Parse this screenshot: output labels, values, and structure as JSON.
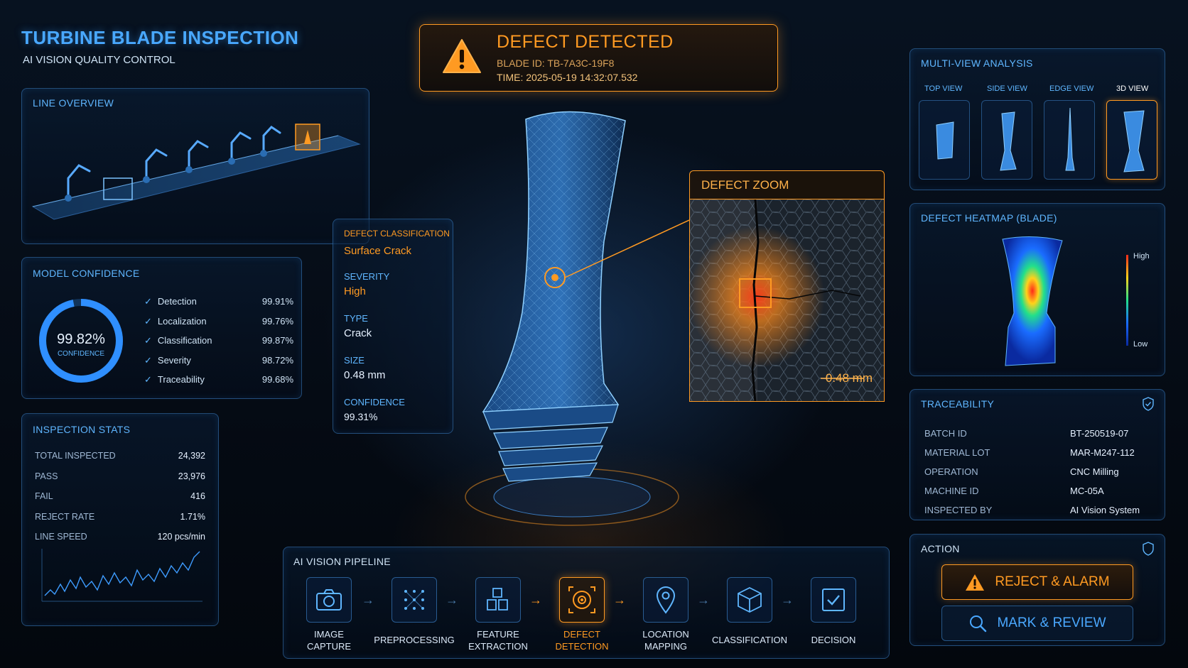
{
  "header": {
    "title": "TURBINE BLADE INSPECTION",
    "subtitle": "AI VISION QUALITY CONTROL"
  },
  "alert": {
    "title": "DEFECT DETECTED",
    "blade_id": "BLADE ID: TB-7A3C-19F8",
    "time": "TIME: 2025-05-19 14:32:07.532",
    "icon": "warning-icon",
    "color": "#ff9a22"
  },
  "line_overview": {
    "title": "LINE OVERVIEW"
  },
  "model_confidence": {
    "title": "MODEL CONFIDENCE",
    "overall_value": "99.82%",
    "overall_label": "CONFIDENCE",
    "overall_fraction": 0.9982,
    "rows": [
      {
        "label": "Detection",
        "value": "99.91%"
      },
      {
        "label": "Localization",
        "value": "99.76%"
      },
      {
        "label": "Classification",
        "value": "99.87%"
      },
      {
        "label": "Severity",
        "value": "98.72%"
      },
      {
        "label": "Traceability",
        "value": "99.68%"
      }
    ]
  },
  "inspection_stats": {
    "title": "INSPECTION STATS",
    "rows": [
      {
        "label": "TOTAL INSPECTED",
        "value": "24,392"
      },
      {
        "label": "PASS",
        "value": "23,976"
      },
      {
        "label": "FAIL",
        "value": "416"
      },
      {
        "label": "REJECT RATE",
        "value": "1.71%"
      },
      {
        "label": "LINE SPEED",
        "value": "120 pcs/min"
      }
    ]
  },
  "defect_classification": {
    "title": "DEFECT CLASSIFICATION",
    "name": "Surface Crack",
    "severity_label": "SEVERITY",
    "severity": "High",
    "type_label": "TYPE",
    "type": "Crack",
    "size_label": "SIZE",
    "size": "0.48 mm",
    "confidence_label": "CONFIDENCE",
    "confidence": "99.31%"
  },
  "defect_zoom": {
    "title": "DEFECT ZOOM",
    "measurement": "0.48 mm"
  },
  "multi_view": {
    "title": "MULTI-VIEW ANALYSIS",
    "views": [
      "TOP VIEW",
      "SIDE VIEW",
      "EDGE VIEW",
      "3D VIEW"
    ],
    "selected": "3D VIEW"
  },
  "heatmap": {
    "title": "DEFECT HEATMAP (BLADE)",
    "high_label": "High",
    "low_label": "Low"
  },
  "traceability": {
    "title": "TRACEABILITY",
    "rows": [
      {
        "label": "BATCH ID",
        "value": "BT-250519-07"
      },
      {
        "label": "MATERIAL LOT",
        "value": "MAR-M247-112"
      },
      {
        "label": "OPERATION",
        "value": "CNC Milling"
      },
      {
        "label": "MACHINE ID",
        "value": "MC-05A"
      },
      {
        "label": "INSPECTED BY",
        "value": "AI Vision System"
      }
    ]
  },
  "action": {
    "title": "ACTION",
    "reject_label": "REJECT & ALARM",
    "review_label": "MARK & REVIEW"
  },
  "pipeline": {
    "title": "AI VISION PIPELINE",
    "steps": [
      {
        "line1": "IMAGE",
        "line2": "CAPTURE",
        "icon": "camera-icon"
      },
      {
        "line1": "PREPROCESSING",
        "line2": "",
        "icon": "grid-icon"
      },
      {
        "line1": "FEATURE",
        "line2": "EXTRACTION",
        "icon": "cubes-icon"
      },
      {
        "line1": "DEFECT",
        "line2": "DETECTION",
        "icon": "target-icon"
      },
      {
        "line1": "LOCATION",
        "line2": "MAPPING",
        "icon": "map-pin-icon"
      },
      {
        "line1": "CLASSIFICATION",
        "line2": "",
        "icon": "cube-icon"
      },
      {
        "line1": "DECISION",
        "line2": "",
        "icon": "checkbox-icon"
      }
    ],
    "active_step": "DEFECT DETECTION"
  },
  "colors": {
    "accent_blue": "#5fb6ff",
    "accent_orange": "#ff9a22",
    "background": "#050b14"
  }
}
